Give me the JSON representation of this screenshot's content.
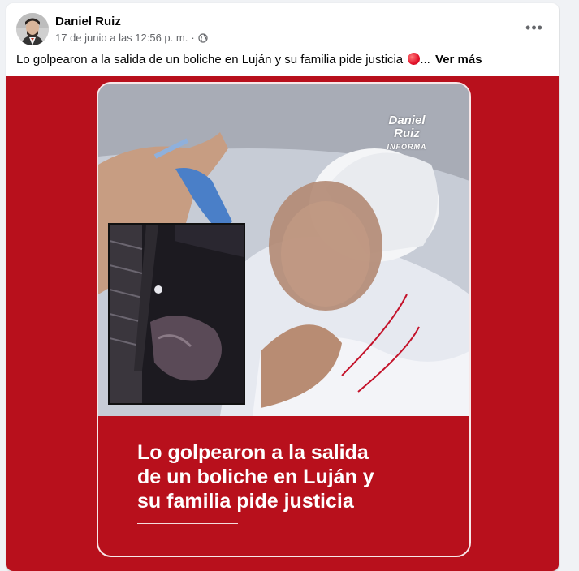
{
  "post": {
    "author": "Daniel Ruiz",
    "timestamp": "17 de junio a las 12:56 p. m.",
    "separator": "·",
    "privacy_icon": "globe-icon",
    "options_icon": "more-options-icon",
    "options_label": "•••",
    "caption_text": "Lo golpearon a la salida de un boliche en Luján y su familia pide justicia",
    "caption_ellipsis": "...",
    "see_more": "Ver más"
  },
  "media": {
    "brand_line1": "Daniel",
    "brand_line2": "Ruiz",
    "brand_line3": "INFORMA",
    "headline_line1": "Lo golpearon a la salida",
    "headline_line2": "de un boliche en Luján y",
    "headline_line3": "su familia pide justicia"
  },
  "colors": {
    "background": "#f0f2f5",
    "card": "#ffffff",
    "media_red": "#b8101c",
    "text_primary": "#050505",
    "text_secondary": "#65676b"
  }
}
